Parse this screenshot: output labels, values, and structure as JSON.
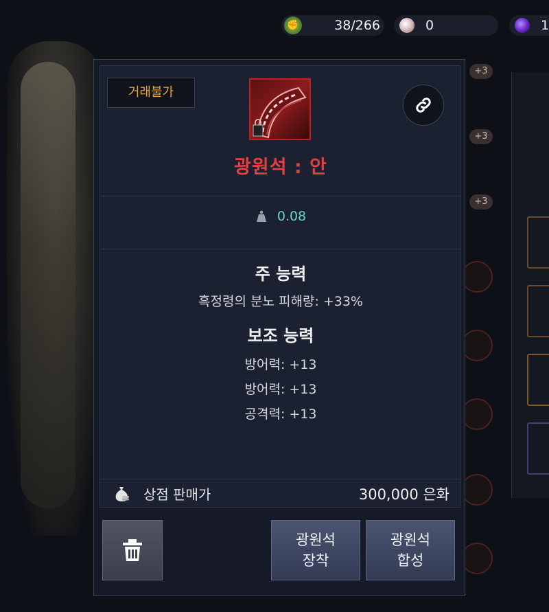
{
  "currencies": [
    {
      "icon": "fist-token-icon",
      "value": "38/266"
    },
    {
      "icon": "pearl-icon",
      "value": "0"
    },
    {
      "icon": "purple-gem-icon",
      "value": "1"
    }
  ],
  "item": {
    "trade_badge": "거래불가",
    "name": "광원석 : 안",
    "weight": "0.08",
    "main_ability_title": "주 능력",
    "main_abilities": [
      "흑정령의 분노 피해량: +33%"
    ],
    "sub_ability_title": "보조 능력",
    "sub_abilities": [
      "방어력: +13",
      "방어력: +13",
      "공격력: +13"
    ],
    "sell_label": "상점 판매가",
    "sell_value": "300,000 은화"
  },
  "buttons": {
    "equip_line1": "광원석",
    "equip_line2": "장착",
    "fuse_line1": "광원석",
    "fuse_line2": "합성"
  },
  "background": {
    "plus_badges": [
      "+3",
      "+3",
      "+3"
    ]
  },
  "colors": {
    "item_name": "#e34141",
    "trade_badge": "#e7a83a",
    "weight": "#67d8c2",
    "panel_bg": "#1b2130"
  }
}
